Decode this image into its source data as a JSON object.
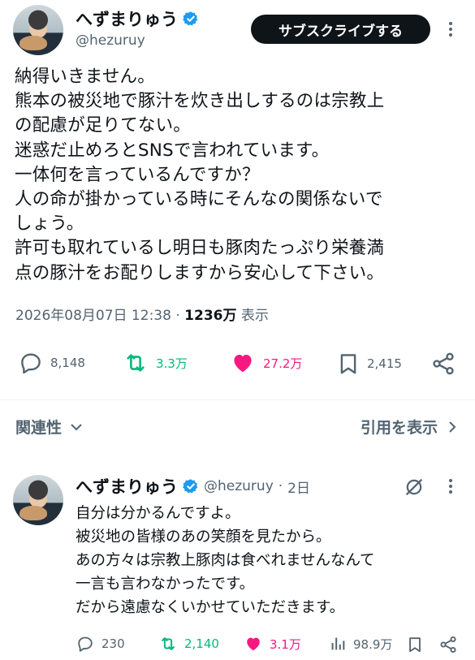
{
  "main_tweet": {
    "author_name": "へずまりゅう",
    "author_handle": "@hezuruy",
    "subscribe_label": "サブスクライブする",
    "text_lines": [
      "納得いきません。",
      "熊本の被災地で豚汁を炊き出しするのは宗教上",
      "の配慮が足りてない。",
      "迷惑だ止めろとSNSで言われています。",
      "一体何を言っているんですか？",
      "人の命が掛かっている時にそんなの関係ないで",
      "しょう。",
      "許可も取れているし明日も豚肉たっぷり栄養満",
      "点の豚汁をお配りしますから安心して下さい。"
    ],
    "timestamp": "2026年08月07日 12:38",
    "separator": "·",
    "views": "1236万",
    "views_label": "表示",
    "replies": "8,148",
    "reposts": "3.3万",
    "likes": "27.2万",
    "bookmarks": "2,415"
  },
  "related": {
    "label": "関連性",
    "quotes_label": "引用を表示"
  },
  "reply_tweet": {
    "author_name": "へずまりゅう",
    "author_handle": "@hezuruy",
    "separator": "·",
    "time_ago": "2日",
    "text_lines": [
      "自分は分かるんですよ。",
      "被災地の皆様のあの笑顔を見たから。",
      "あの方々は宗教上豚肉は食べれませんなんて",
      "一言も言わなかったです。",
      "だから遠慮なくいかせていただきます。"
    ],
    "replies": "230",
    "reposts": "2,140",
    "likes": "3.1万",
    "views": "98.9万"
  },
  "colors": {
    "verified": "#1d9bf0",
    "repost": "#00ba7c",
    "like": "#f91880",
    "muted": "#536471",
    "text": "#0f1419"
  }
}
